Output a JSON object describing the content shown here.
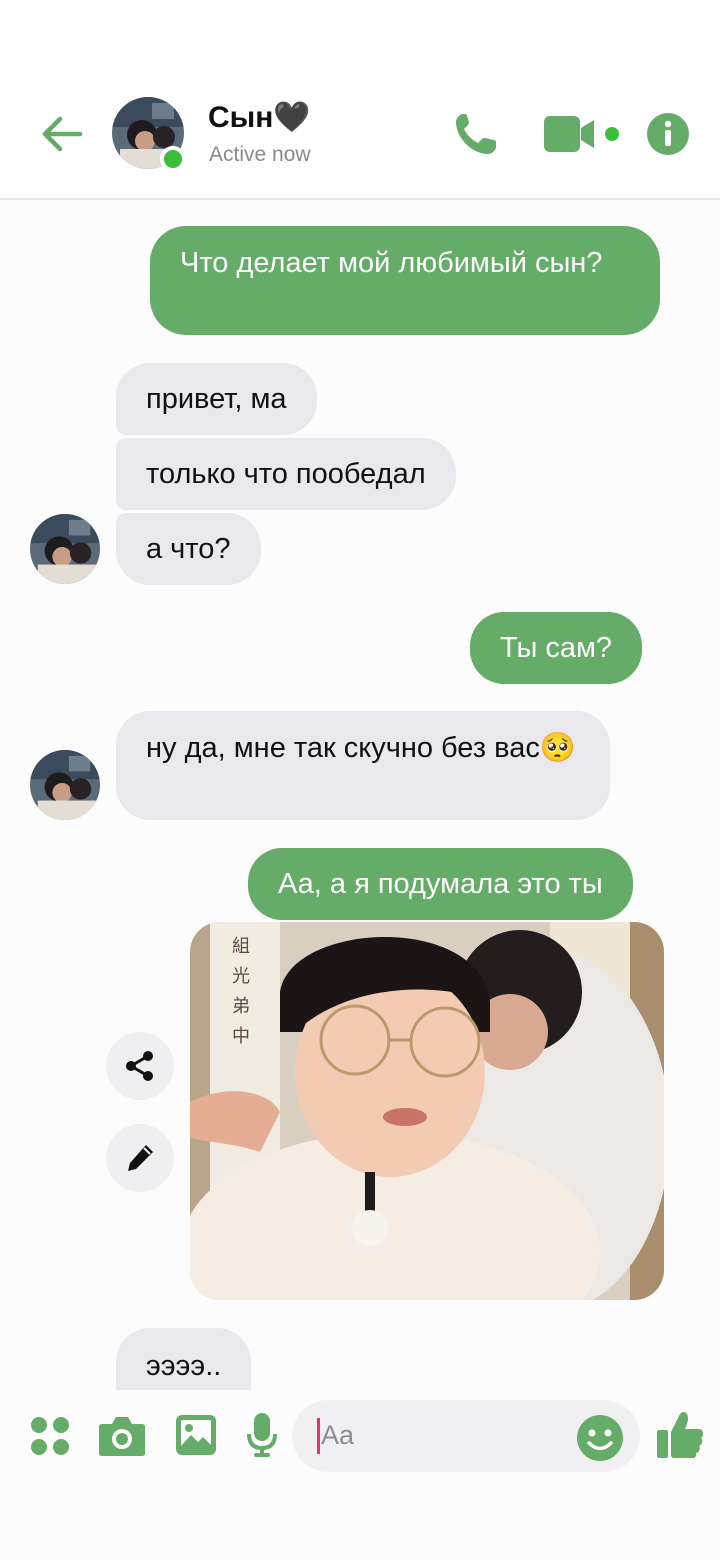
{
  "header": {
    "back_icon": "arrow-left-icon",
    "contact_name": "Сын🖤",
    "status": "Active now",
    "actions": [
      "phone-icon",
      "video-camera-icon",
      "info-icon"
    ]
  },
  "messages": [
    {
      "side": "outgoing",
      "text": "Что делает мой любимый сын?"
    },
    {
      "side": "incoming",
      "text": "привет, ма"
    },
    {
      "side": "incoming",
      "text": "только что пообедал"
    },
    {
      "side": "incoming",
      "text": "а что?"
    },
    {
      "side": "outgoing",
      "text": "Ты сам?"
    },
    {
      "side": "incoming",
      "text": "ну да, мне так скучно без вас🥺"
    },
    {
      "side": "outgoing",
      "text": "Аа, а я подумала это ты"
    },
    {
      "side": "outgoing",
      "type": "photo"
    },
    {
      "side": "incoming",
      "text": "ээээ.."
    }
  ],
  "photo_actions": [
    "share-icon",
    "edit-pencil-icon"
  ],
  "composer": {
    "placeholder": "Aa",
    "tools": [
      "apps-icon",
      "camera-icon",
      "gallery-icon",
      "microphone-icon",
      "emoji-icon",
      "thumbs-up-icon"
    ]
  },
  "colors": {
    "accent": "#66ac69",
    "incoming_bubble": "#e9e8ec",
    "online": "#3bbf3b"
  }
}
